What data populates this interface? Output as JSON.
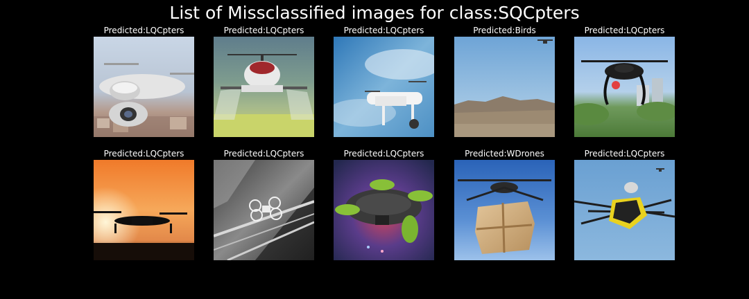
{
  "title": "List of Missclassified images for class:SQCpters",
  "images": [
    {
      "predicted": "Predicted:LQCpters"
    },
    {
      "predicted": "Predicted:LQCpters"
    },
    {
      "predicted": "Predicted:LQCpters"
    },
    {
      "predicted": "Predicted:Birds"
    },
    {
      "predicted": "Predicted:LQCpters"
    },
    {
      "predicted": "Predicted:LQCpters"
    },
    {
      "predicted": "Predicted:LQCpters"
    },
    {
      "predicted": "Predicted:LQCpters"
    },
    {
      "predicted": "Predicted:WDrones"
    },
    {
      "predicted": "Predicted:LQCpters"
    }
  ]
}
